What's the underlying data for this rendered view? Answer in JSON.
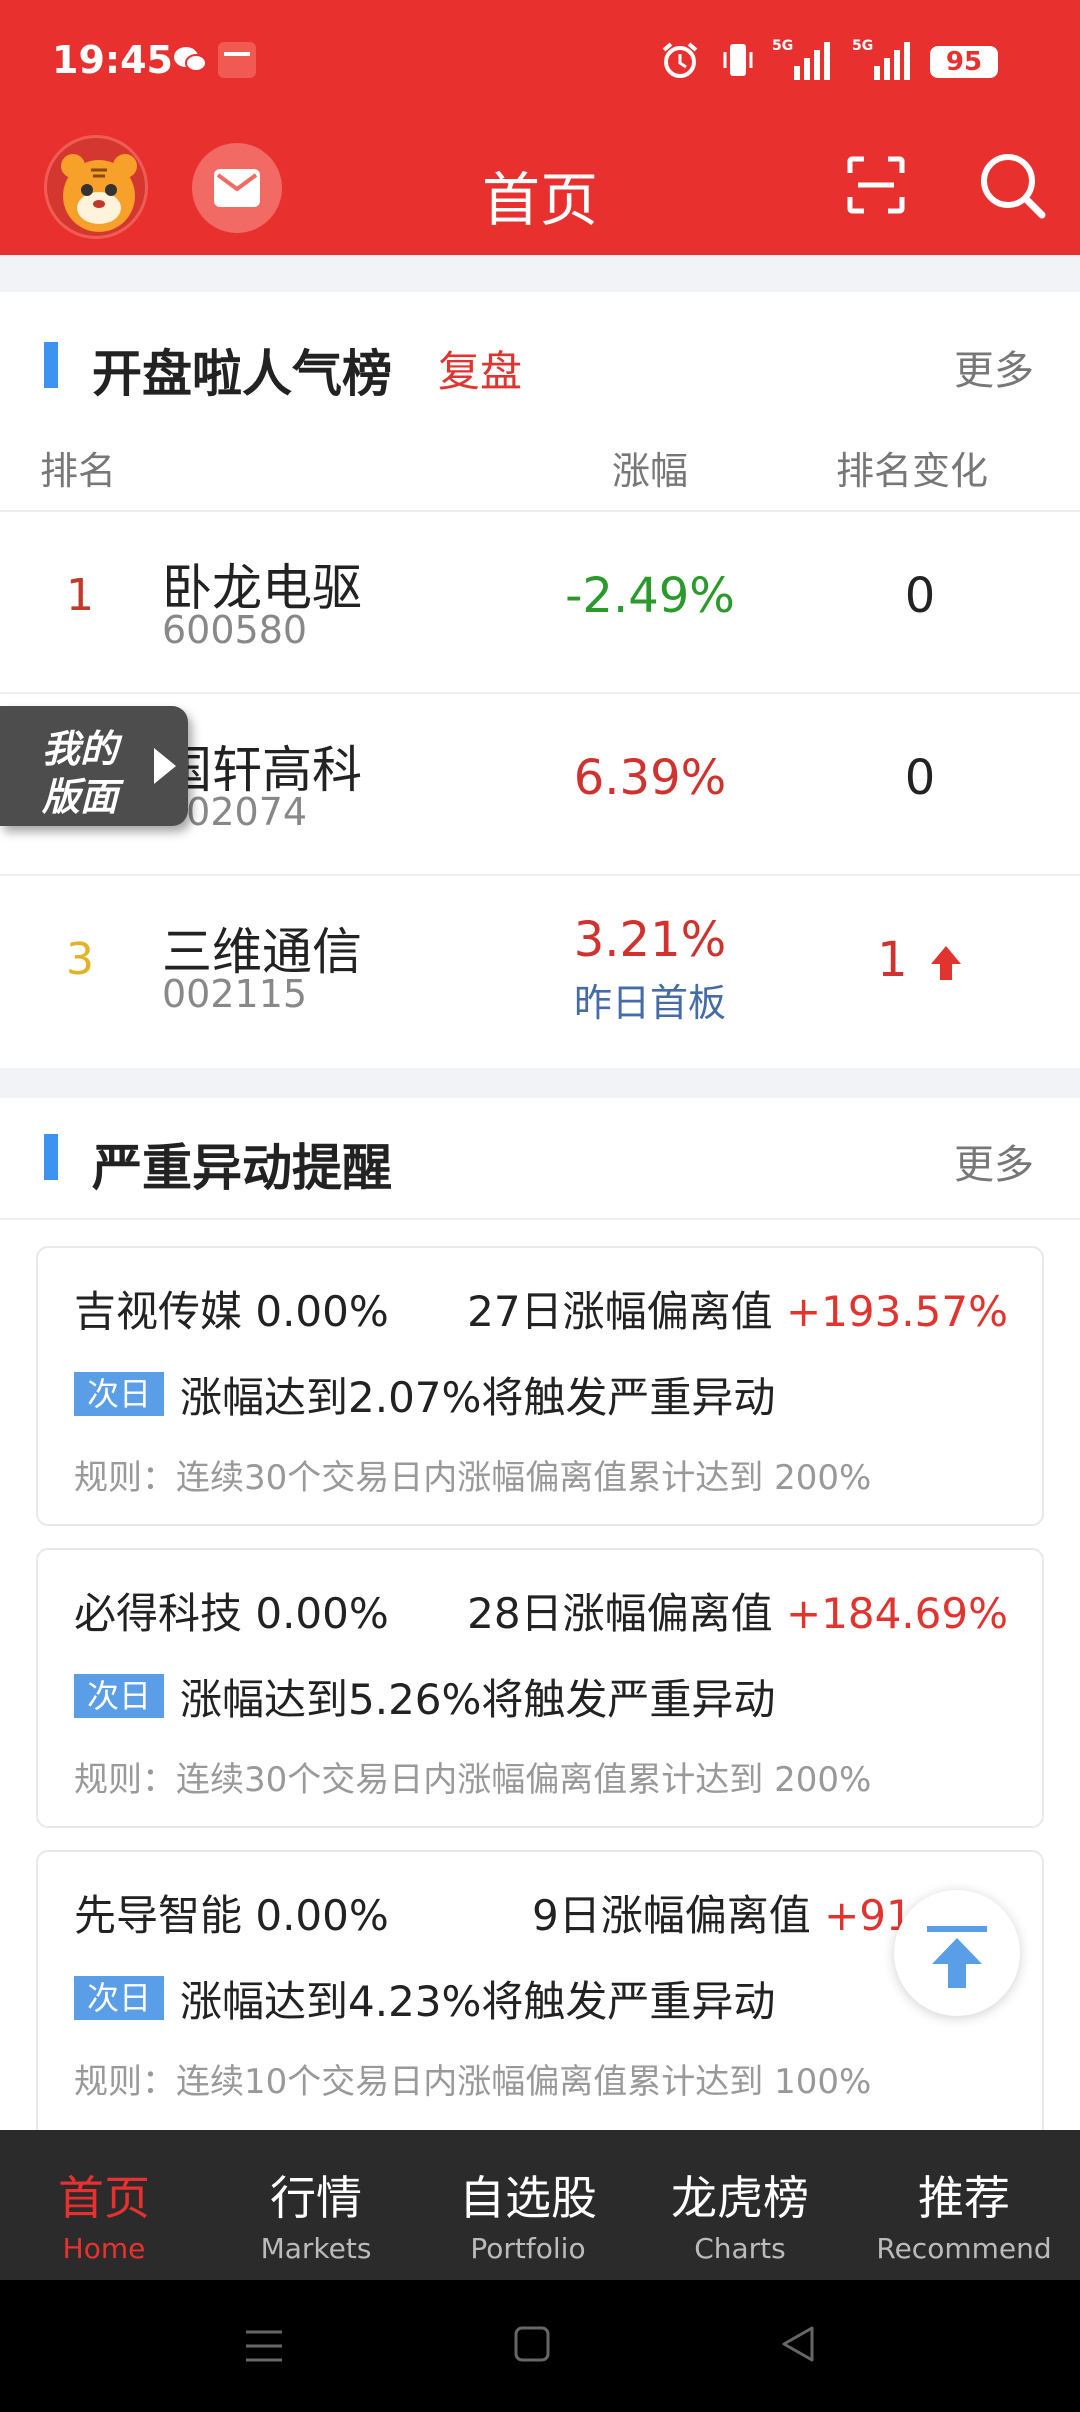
{
  "status": {
    "time": "19:45",
    "battery": "95"
  },
  "header": {
    "title": "首页"
  },
  "popular": {
    "title": "开盘啦人气榜",
    "sub": "复盘",
    "more": "更多",
    "columns": {
      "rank": "排名",
      "change": "涨幅",
      "rank_change": "排名变化"
    },
    "rows": [
      {
        "rank": "1",
        "name": "卧龙电驱",
        "code": "600580",
        "change": "-2.49%",
        "rank_change": "0",
        "note": ""
      },
      {
        "rank": "",
        "name": "国轩高科",
        "code": "002074",
        "change": "6.39%",
        "rank_change": "0",
        "note": ""
      },
      {
        "rank": "3",
        "name": "三维通信",
        "code": "002115",
        "change": "3.21%",
        "rank_change": "1",
        "note": "昨日首板"
      }
    ]
  },
  "my_panel": {
    "line1": "我的",
    "line2": "版面"
  },
  "alerts_section": {
    "title": "严重异动提醒",
    "more": "更多",
    "items": [
      {
        "name": "吉视传媒 0.00%",
        "dev_label": "27日涨幅偏离值 ",
        "dev_value": "+193.57%",
        "tag": "次日",
        "msg": "涨幅达到2.07%将触发严重异动",
        "rule": "规则：连续30个交易日内涨幅偏离值累计达到 200%"
      },
      {
        "name": "必得科技 0.00%",
        "dev_label": "28日涨幅偏离值 ",
        "dev_value": "+184.69%",
        "tag": "次日",
        "msg": "涨幅达到5.26%将触发严重异动",
        "rule": "规则：连续30个交易日内涨幅偏离值累计达到 200%"
      },
      {
        "name": "先导智能 0.00%",
        "dev_label": "9日涨幅偏离值 ",
        "dev_value": "+91",
        "tag": "次日",
        "msg": "涨幅达到4.23%将触发严重异动",
        "rule": "规则：连续10个交易日内涨幅偏离值累计达到 100%"
      }
    ]
  },
  "tabs": [
    {
      "zh": "首页",
      "en": "Home"
    },
    {
      "zh": "行情",
      "en": "Markets"
    },
    {
      "zh": "自选股",
      "en": "Portfolio"
    },
    {
      "zh": "龙虎榜",
      "en": "Charts"
    },
    {
      "zh": "推荐",
      "en": "Recommend"
    }
  ],
  "colors": {
    "brand": "#e8312f",
    "up": "#d0322e",
    "down": "#2a9a2a",
    "rank3": "#e2b227",
    "tag": "#5a9ee8"
  }
}
